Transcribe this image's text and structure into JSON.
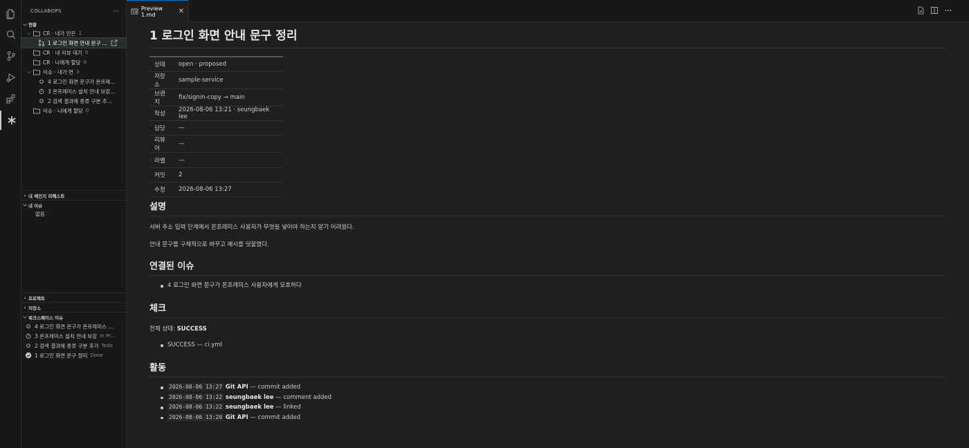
{
  "sidebar": {
    "title": "COLLABOPS",
    "more": "···",
    "status_header": "현황",
    "tree": [
      {
        "label": "CR · 내가 만든",
        "count": "1"
      },
      {
        "label": "1 로그인 화면 안내 문구 ..."
      },
      {
        "label": "CR · 내 리뷰 대기",
        "count": "0"
      },
      {
        "label": "CR · 나에게 할당",
        "count": "0"
      },
      {
        "label": "이슈 · 내가 연",
        "count": "3"
      },
      {
        "label": "4  로그인 화면 문구가 온프레..."
      },
      {
        "label": "3  온프레미스 설치 안내 보강..."
      },
      {
        "label": "2  검색 결과에 종류 구분 추..."
      },
      {
        "label": "이슈 · 나에게 할당",
        "count": "0"
      }
    ],
    "sections": {
      "my_changes": "내 체인지 리퀘스트",
      "my_issues": "내 이슈",
      "none": "없음",
      "projects": "프로젝트",
      "repos": "저장소",
      "workspace_issues": "워크스페이스 이슈"
    },
    "ws_issues": [
      {
        "label": "4  로그인 화면 문구가 온프레미스 ...",
        "status": ""
      },
      {
        "label": "3  온프레미스 설치 안내 보강",
        "status": "In Pr..."
      },
      {
        "label": "2  검색 결과에 종류 구분 추가",
        "status": "Todo"
      },
      {
        "label": "1  로그인 화면 문구 정리",
        "status": "Done"
      }
    ]
  },
  "editor": {
    "tab_label": "Preview 1.md",
    "title": "1 로그인 화면 안내 문구 정리",
    "meta": [
      {
        "k": "상태",
        "v": "open · proposed"
      },
      {
        "k": "저장소",
        "v": "sample-service"
      },
      {
        "k": "브랜치",
        "v": "fix/signin-copy → main"
      },
      {
        "k": "작성",
        "v": "2026-08-06 13:21 · seungbaek lee"
      },
      {
        "k": "담당",
        "v": "—"
      },
      {
        "k": "리뷰어",
        "v": "—"
      },
      {
        "k": "라벨",
        "v": "—"
      },
      {
        "k": "커밋",
        "v": "2"
      },
      {
        "k": "수정",
        "v": "2026-08-06 13:27"
      }
    ],
    "desc_heading": "설명",
    "desc_p1": "서버 주소 입력 단계에서 온프레미스 사용자가 무엇을 넣어야 하는지 알기 어려웠다.",
    "desc_p2": "안내 문구를 구체적으로 바꾸고 예시를 덧붙였다.",
    "linked_heading": "연결된 이슈",
    "linked_item": "4 로그인 화면 문구가 온프레미스 사용자에게 모호하다",
    "check_heading": "체크",
    "check_label": "전체 상태: ",
    "check_status": "SUCCESS",
    "check_item": "SUCCESS — ci.yml",
    "activity_heading": "활동",
    "activity": [
      {
        "time": "2026-08-06 13:27",
        "who": "Git API",
        "what": " — commit added"
      },
      {
        "time": "2026-08-06 13:22",
        "who": "seungbaek lee",
        "what": " — comment added"
      },
      {
        "time": "2026-08-06 13:22",
        "who": "seungbaek lee",
        "what": " — linked"
      },
      {
        "time": "2026-08-06 13:20",
        "who": "Git API",
        "what": " — commit added"
      }
    ]
  }
}
